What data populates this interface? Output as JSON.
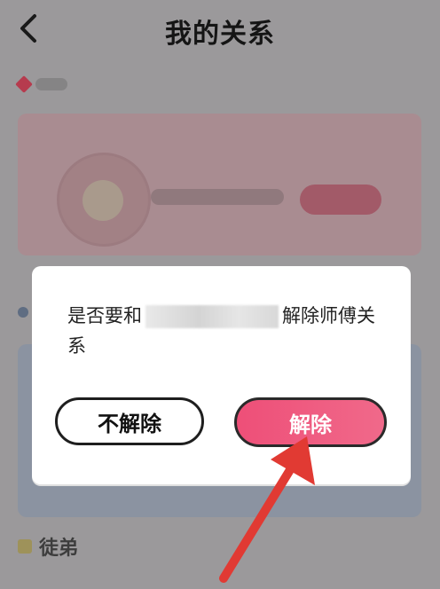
{
  "header": {
    "title": "我的关系"
  },
  "background": {
    "lower_section_label": "徒弟"
  },
  "dialog": {
    "message_prefix": "是否要和",
    "message_suffix": "解除师傅关系",
    "cancel_label": "不解除",
    "confirm_label": "解除"
  },
  "colors": {
    "confirm": "#ee4f78",
    "annotation_arrow": "#e13a33"
  }
}
